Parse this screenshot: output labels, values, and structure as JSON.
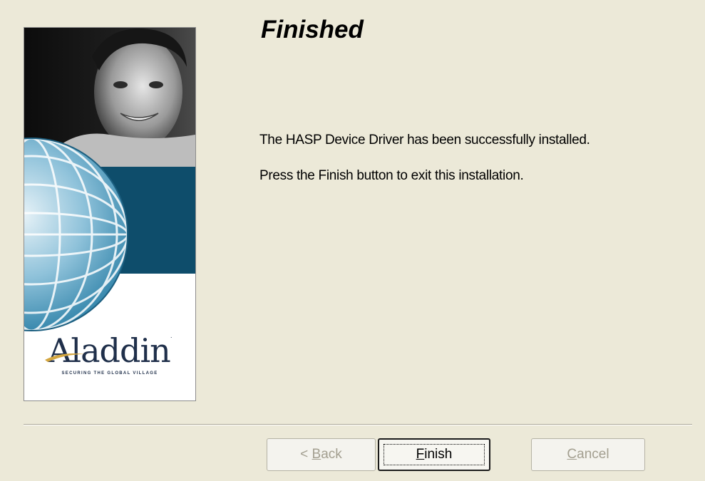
{
  "wizard": {
    "title": "Finished",
    "messages": [
      "The HASP Device Driver has been successfully installed.",
      "Press the Finish button to exit this installation."
    ]
  },
  "banner": {
    "logo_text": "Aladdin",
    "tagline": "SECURING THE GLOBAL VILLAGE",
    "colors": {
      "band": "#0e4d6b",
      "globe_light": "#cfe3ee",
      "globe_dark": "#2a7fa6",
      "logo": "#1f2f4a",
      "swoosh": "#d4a640"
    }
  },
  "buttons": {
    "back": {
      "prefix": "< ",
      "mnemonic": "B",
      "rest": "ack",
      "enabled": false
    },
    "finish": {
      "mnemonic": "F",
      "rest": "inish",
      "enabled": true,
      "focused": true
    },
    "cancel": {
      "mnemonic": "C",
      "rest": "ancel",
      "enabled": false
    }
  }
}
